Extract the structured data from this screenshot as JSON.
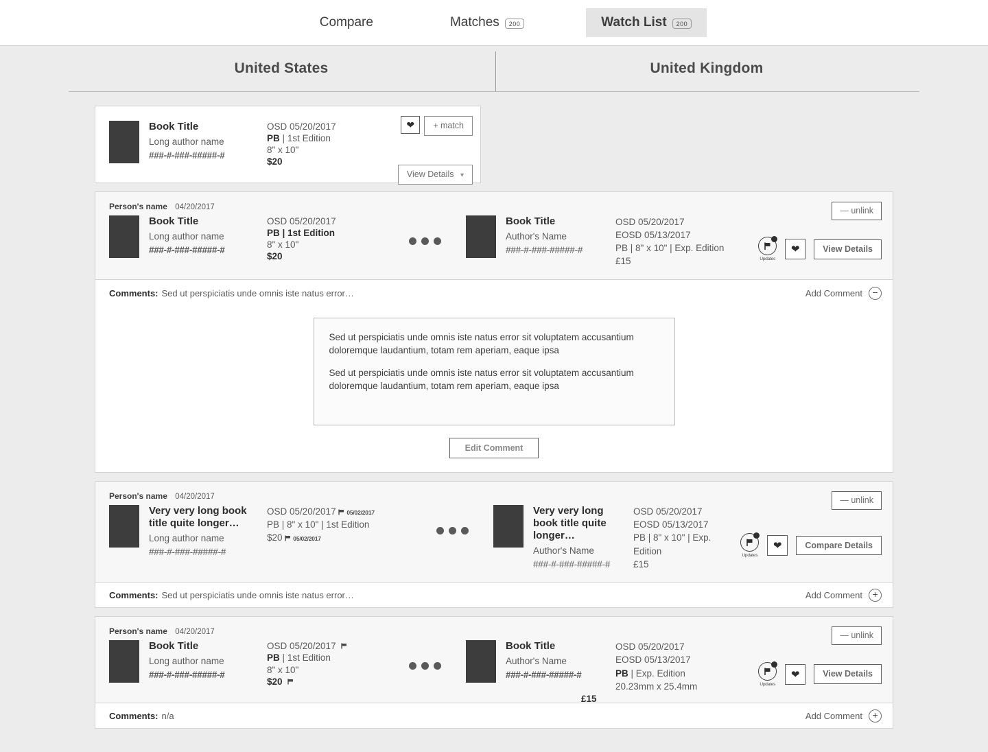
{
  "nav": {
    "tabs": [
      {
        "label": "Compare",
        "badge": null,
        "active": false
      },
      {
        "label": "Matches",
        "badge": "200",
        "active": false
      },
      {
        "label": "Watch List",
        "badge": "200",
        "active": true
      }
    ]
  },
  "columns": {
    "left": "United States",
    "right": "United Kingdom"
  },
  "single_card": {
    "title": "Book Title",
    "author": "Long author name",
    "isbn": "###-#-###-#####-#",
    "osd": "OSD 05/20/2017",
    "format": "PB",
    "format_sep": "|",
    "edition": "1st Edition",
    "size": "8\" x 10\"",
    "price": "$20",
    "favorite_icon": "heart-icon",
    "match_label": "+ match",
    "details_label": "View Details",
    "caret_icon": "chevron-down-icon"
  },
  "rows": [
    {
      "person": "Person's name",
      "date": "04/20/2017",
      "unlink_label": "unlink",
      "left": {
        "title": "Book Title",
        "author": "Long author name",
        "isbn": "###-#-###-#####-#",
        "lines": [
          "OSD 05/20/2017",
          "PB | 1st Edition",
          "8\" x 10\"",
          "$20"
        ]
      },
      "right": {
        "title": "Book Title",
        "author": "Author's Name",
        "isbn": "###-#-###-#####-#",
        "lines": [
          "OSD 05/20/2017",
          "EOSD 05/13/2017",
          "PB | 8\" x 10\" | Exp. Edition",
          "£15"
        ]
      },
      "updates_label": "Updates",
      "details_label": "View Details",
      "comments_label": "Comments:",
      "comments_preview": "Sed ut perspiciatis unde omnis iste natus error…",
      "add_comment_label": "Add Comment",
      "toggle_icon": "minus-circle-icon",
      "expanded": true,
      "comment_paragraphs": [
        "Sed ut perspiciatis unde omnis iste natus error sit voluptatem accusantium doloremque laudantium, totam rem aperiam, eaque ipsa",
        "Sed ut perspiciatis unde omnis iste natus error sit voluptatem accusantium doloremque laudantium, totam rem aperiam, eaque ipsa"
      ],
      "edit_comment_label": "Edit Comment"
    },
    {
      "person": "Person's name",
      "date": "04/20/2017",
      "unlink_label": "unlink",
      "left": {
        "title": "Very very long book title quite longer…",
        "author": "Long author name",
        "isbn": "###-#-###-#####-#",
        "osd": "OSD 05/20/2017",
        "osd_flag": "05/02/2017",
        "spec": "PB | 8\" x 10\" | 1st Edition",
        "price": "$20",
        "price_flag": "05/02/2017"
      },
      "right": {
        "title": "Very very long book title quite longer…",
        "author": "Author's Name",
        "isbn": "###-#-###-#####-#",
        "lines": [
          "OSD 05/20/2017",
          "EOSD 05/13/2017",
          "PB | 8\" x 10\" | Exp. Edition",
          "£15"
        ]
      },
      "updates_label": "Updates",
      "details_label": "Compare Details",
      "comments_label": "Comments:",
      "comments_preview": "Sed ut perspiciatis unde omnis iste natus error…",
      "add_comment_label": "Add Comment",
      "toggle_icon": "plus-circle-icon",
      "expanded": false
    },
    {
      "person": "Person's name",
      "date": "04/20/2017",
      "unlink_label": "unlink",
      "left": {
        "title": "Book Title",
        "author": "Long author name",
        "isbn": "###-#-###-#####-#",
        "osd": "OSD 05/20/2017",
        "osd_flag": "",
        "format": "PB",
        "edition": "1st Edition",
        "size": "8\" x 10\"",
        "price": "$20",
        "price_flag": ""
      },
      "right": {
        "title": "Book Title",
        "author": "Author's Name",
        "isbn": "###-#-###-#####-#",
        "osd": "OSD 05/20/2017",
        "eosd": "EOSD 05/13/2017",
        "format": "PB",
        "edition": "| Exp. Edition",
        "size": "20.23mm x 25.4mm",
        "price": "£15"
      },
      "updates_label": "Updates",
      "details_label": "View Details",
      "comments_label": "Comments:",
      "comments_preview": "n/a",
      "add_comment_label": "Add Comment",
      "toggle_icon": "plus-circle-icon",
      "expanded": false
    }
  ]
}
